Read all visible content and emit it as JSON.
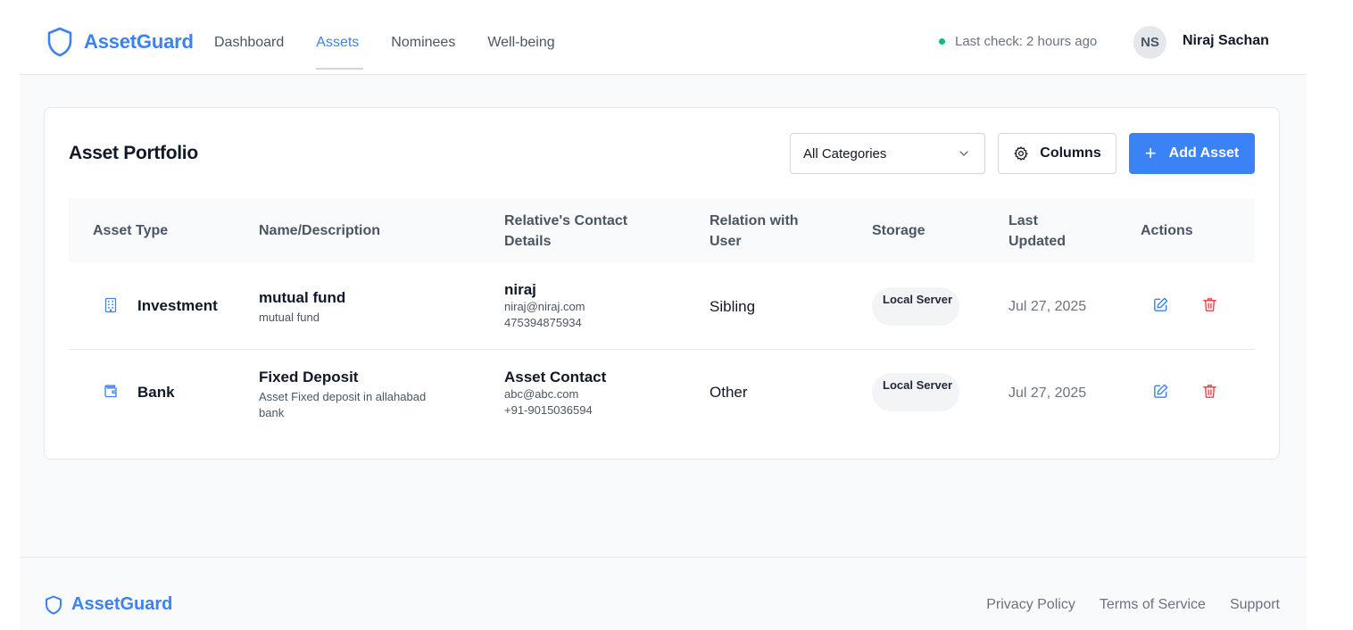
{
  "brand": {
    "name": "AssetGuard",
    "icon": "shield-icon"
  },
  "nav": {
    "items": [
      "Dashboard",
      "Assets",
      "Nominees",
      "Well-being"
    ],
    "active": "Assets"
  },
  "status": {
    "text": "Last check: 2 hours ago",
    "color": "#10b981"
  },
  "user": {
    "initials": "NS",
    "name": "Niraj Sachan"
  },
  "portfolio": {
    "title": "Asset Portfolio",
    "filter": {
      "selected": "All Categories"
    },
    "columns_button": "Columns",
    "add_button": "Add Asset",
    "headers": [
      "Asset Type",
      "Name/Description",
      "Relative's Contact Details",
      "Relation with User",
      "Storage",
      "Last Updated",
      "Actions"
    ],
    "rows": [
      {
        "type": "Investment",
        "type_icon": "building-icon",
        "name": "mutual fund",
        "description": "mutual fund",
        "contact_name": "niraj",
        "contact_email": "niraj@niraj.com",
        "contact_phone": "475394875934",
        "relation": "Sibling",
        "storage": "Local Server",
        "updated": "Jul 27, 2025"
      },
      {
        "type": "Bank",
        "type_icon": "wallet-icon",
        "name": "Fixed Deposit",
        "description": "Asset Fixed deposit in allahabad bank",
        "contact_name": "Asset Contact",
        "contact_email": "abc@abc.com",
        "contact_phone": "+91-9015036594",
        "relation": "Other",
        "storage": "Local Server",
        "updated": "Jul 27, 2025"
      }
    ]
  },
  "footer": {
    "brand": "AssetGuard",
    "links": [
      "Privacy Policy",
      "Terms of Service",
      "Support"
    ]
  },
  "colors": {
    "accent": "#3b82f6",
    "danger": "#ef4444",
    "success": "#10b981"
  }
}
